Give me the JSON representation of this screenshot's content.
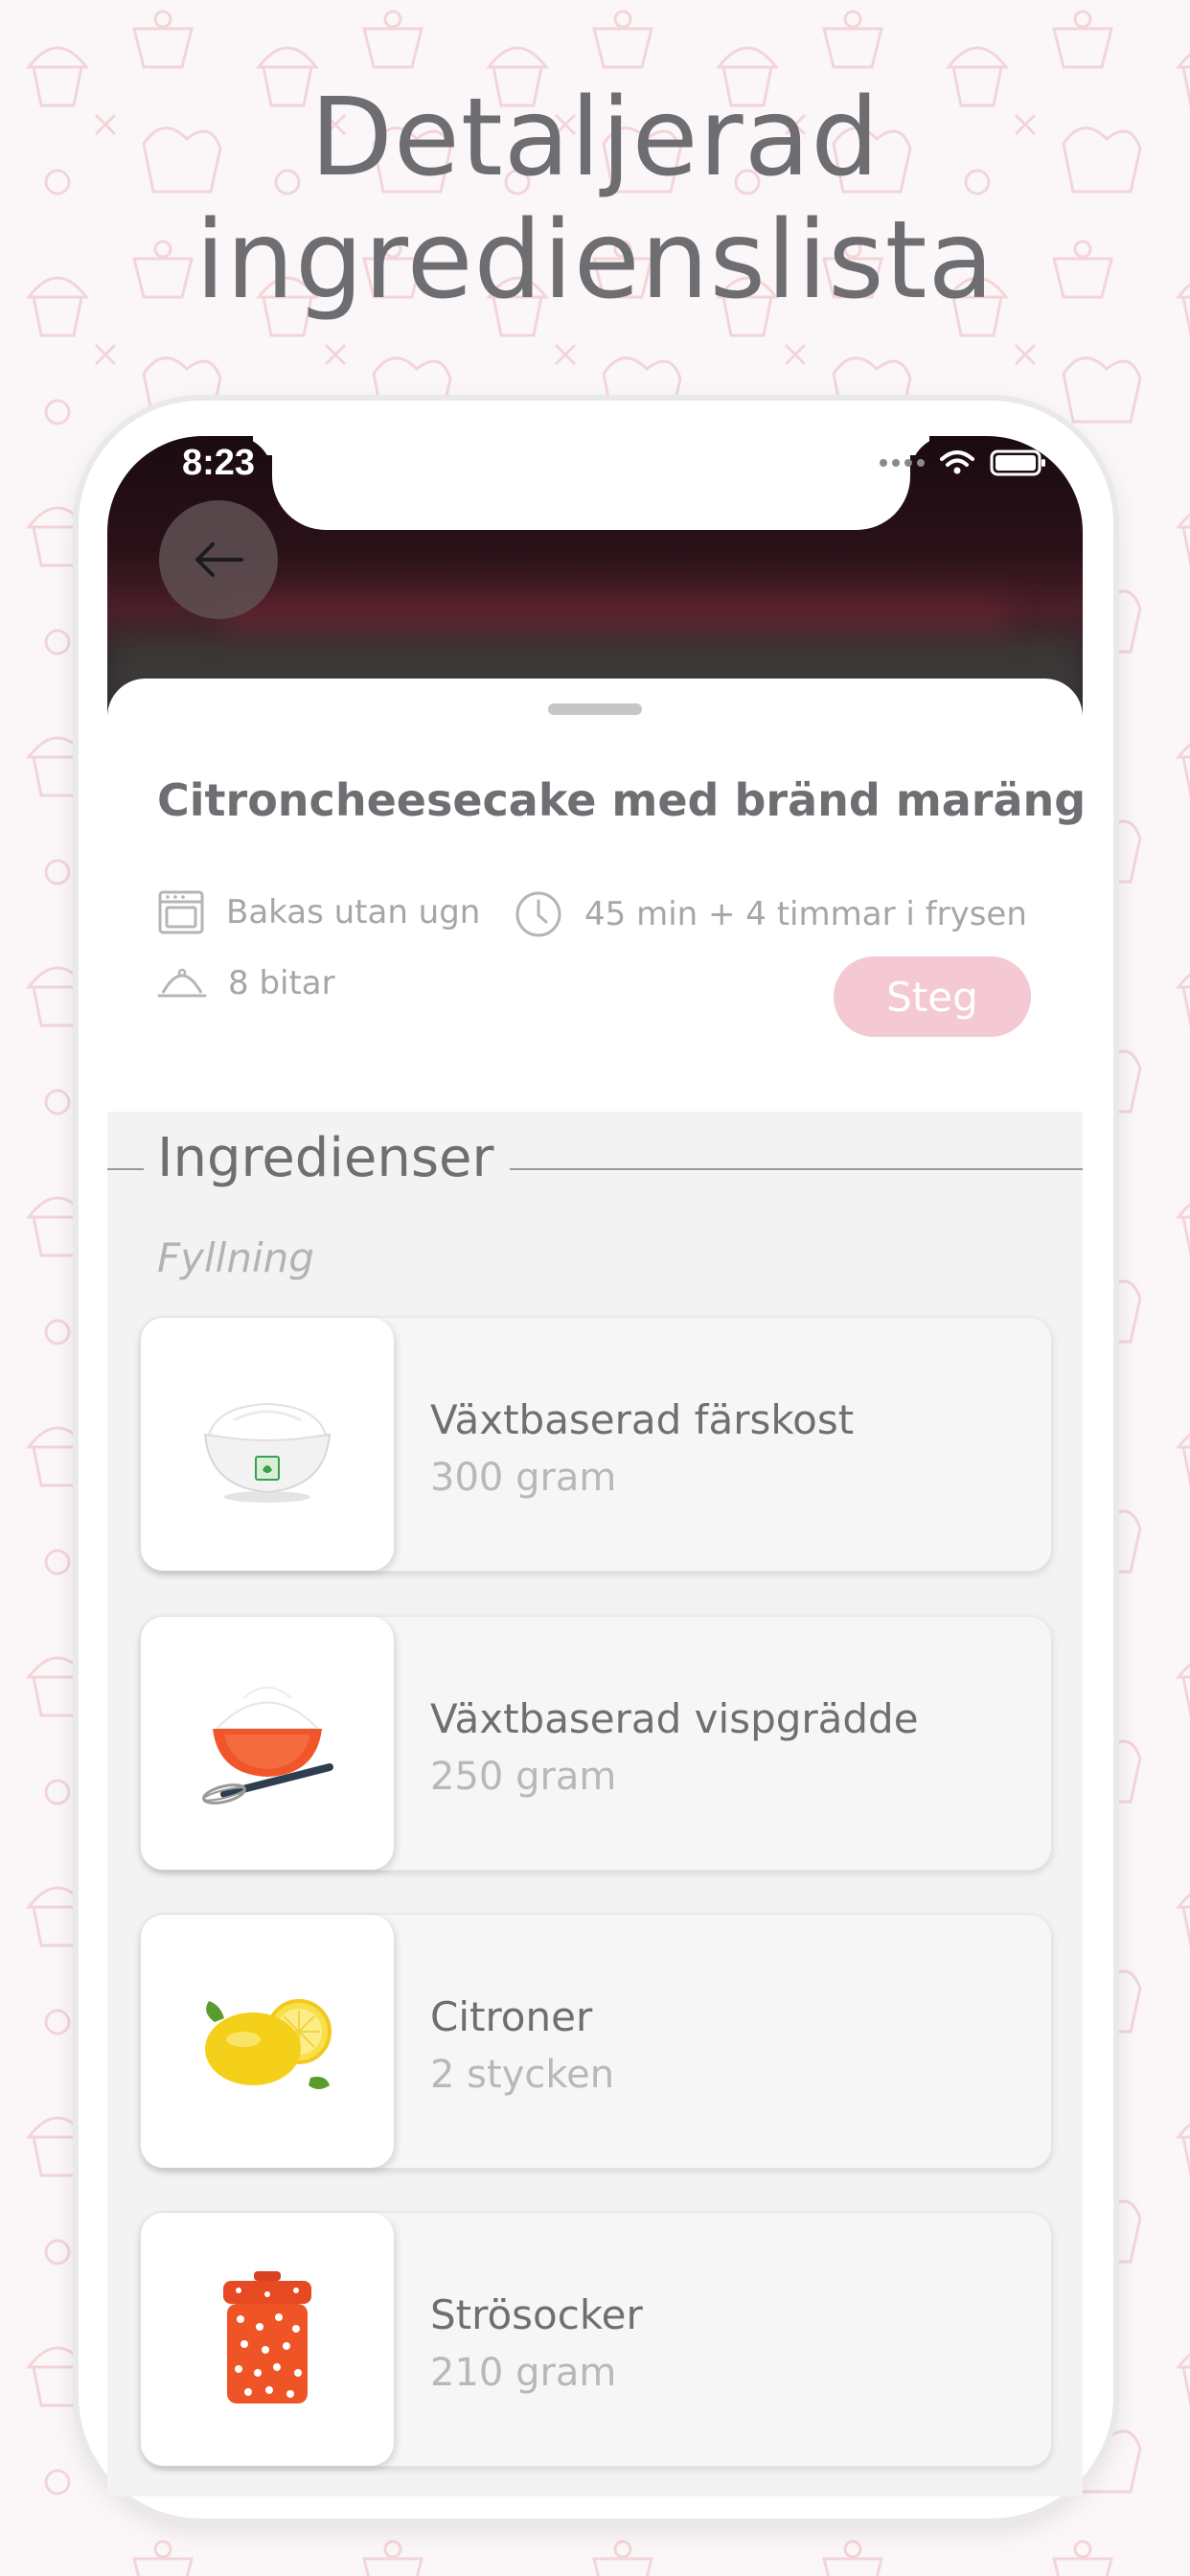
{
  "headline": {
    "line1": "Detaljerad",
    "line2": "ingredienslista"
  },
  "status_bar": {
    "time": "8:23"
  },
  "colors": {
    "accent": "#f4c9d4",
    "text": "#6f6f73",
    "muted": "#a6a6a9",
    "section_bg": "#f3f3f4",
    "background_pattern": "#f1c9cf"
  },
  "recipe": {
    "title": "Citroncheesecake med bränd maräng",
    "meta": {
      "oven": "Bakas utan ugn",
      "time": "45 min + 4 timmar i frysen",
      "yield": "8 bitar"
    },
    "steps_button": "Steg"
  },
  "icons": {
    "back": "arrow-left-icon",
    "oven": "oven-icon",
    "time": "clock-icon",
    "yield": "cloche-icon"
  },
  "ingredients": {
    "heading": "Ingredienser",
    "section": "Fyllning",
    "items": [
      {
        "name": "Växtbaserad färskost",
        "amount": "300 gram",
        "image": "cream-cheese-bowl"
      },
      {
        "name": "Växtbaserad vispgrädde",
        "amount": "250 gram",
        "image": "whipped-cream-bowl-with-whisk"
      },
      {
        "name": "Citroner",
        "amount": "2 stycken",
        "image": "lemons"
      },
      {
        "name": "Strösocker",
        "amount": "210 gram",
        "image": "sugar-canister"
      }
    ]
  }
}
